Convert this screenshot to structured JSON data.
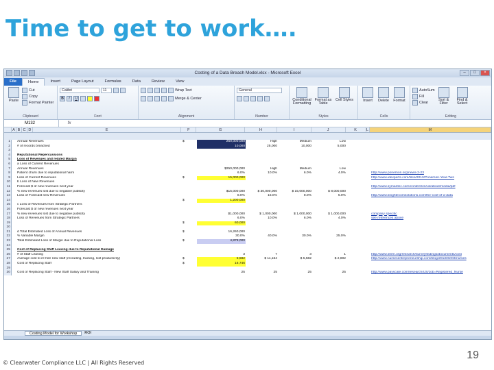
{
  "slide": {
    "title": "Time to get to work….",
    "footer": "© Clearwater Compliance LLC | All Rights Reserved",
    "page_number": "19"
  },
  "excel": {
    "window_title": "Costing of a Data Breach Model.xlsx - Microsoft Excel",
    "tabs": [
      "File",
      "Home",
      "Insert",
      "Page Layout",
      "Formulas",
      "Data",
      "Review",
      "View"
    ],
    "ribbon": {
      "clipboard": {
        "paste": "Paste",
        "cut": "Cut",
        "copy": "Copy",
        "format_painter": "Format Painter",
        "label": "Clipboard"
      },
      "font": {
        "name": "Calibri",
        "size": "11",
        "label": "Font"
      },
      "alignment": {
        "wrap": "Wrap Text",
        "merge": "Merge & Center",
        "label": "Alignment"
      },
      "number": {
        "format": "General",
        "label": "Number"
      },
      "styles": {
        "conditional": "Conditional Formatting",
        "format_table": "Format as Table",
        "cell_styles": "Cell Styles",
        "label": "Styles"
      },
      "cells": {
        "insert": "Insert",
        "delete": "Delete",
        "format": "Format",
        "label": "Cells"
      },
      "editing": {
        "autosum": "AutoSum",
        "fill": "Fill",
        "clear": "Clear",
        "sort": "Sort & Filter",
        "find": "Find & Select",
        "label": "Editing"
      }
    },
    "name_box": "M132",
    "fx": "fx",
    "columns": [
      "A",
      "B",
      "C",
      "D",
      "E",
      "F",
      "G",
      "H",
      "I",
      "J",
      "K",
      "L",
      "M"
    ],
    "rows": [
      {
        "n": "1",
        "e": "Annual Revenues",
        "f": "$",
        "g": "250,000,000",
        "h": "High",
        "i": "Medium",
        "j": "Low",
        "gcls": "hl-navy"
      },
      {
        "n": "2",
        "e": "# of records breached",
        "g": "10,000",
        "h": "25,000",
        "i": "10,000",
        "j": "5,000",
        "gcls": "hl-navy"
      },
      {
        "n": "3"
      },
      {
        "n": "4",
        "e": "Reputational Repercussions",
        "ecls": "bold"
      },
      {
        "n": "5",
        "e": "Loss of Revenues and related Margin",
        "ecls": "bold ul"
      },
      {
        "n": "6",
        "e": "a   Loss of Current Revenues"
      },
      {
        "n": "7",
        "e": "      Annual Revenues",
        "g": "$250,000,000",
        "h": "High",
        "i": "Medium",
        "j": "Low"
      },
      {
        "n": "8",
        "e": "      Patient churn due to reputational harm",
        "g": "6.0%",
        "h": "10.0%",
        "i": "6.0%",
        "j": "4.0%",
        "m": "http://www.ponemon.org/news-2-23"
      },
      {
        "n": "9",
        "e": "      Loss of Current Revenues",
        "f": "$",
        "g": "15,000,000",
        "gcls": "hl-yellow",
        "m": "http://www.idexperts.com/files/2013/Ponemon-Year-Two"
      },
      {
        "n": "10",
        "e": "b   Loss of New Revenues"
      },
      {
        "n": "11",
        "e": "      Forecast $ of new revenues next year",
        "m": "http://www.symantec.com/content/en/us/about/media/pdf"
      },
      {
        "n": "12",
        "e": "      % new revenues lost due to negative publicity",
        "g": "$15,000,000",
        "h": "$ 30,000,000",
        "i": "$ 15,000,000",
        "j": "$ 8,000,000"
      },
      {
        "n": "13",
        "e": "      Loss of Forecast new Revenues",
        "g": "8.0%",
        "h": "15.0%",
        "i": "8.0%",
        "j": "5.0%",
        "m": "http://www.knightecomsolutions.com/the-cost-of-a-data"
      },
      {
        "n": "14",
        "e": "",
        "f": "$",
        "g": "1,200,000",
        "gcls": "hl-yellow"
      },
      {
        "n": "15",
        "e": "c   Loss of Revenues from Strategic Partners"
      },
      {
        "n": "16",
        "e": "      Forecast $ of new revenues next year"
      },
      {
        "n": "17",
        "e": "      % new revenues lost due to negative publicity",
        "g": "$1,000,000",
        "h": "$ 1,000,000",
        "i": "$ 1,000,000",
        "j": "$ 1,000,000",
        "m": "company specific"
      },
      {
        "n": "18",
        "e": "      Loss of Revenues from Strategic Partners",
        "g": "6.0%",
        "h": "10.0%",
        "i": "6.0%",
        "j": "4.0%",
        "m": "see references above"
      },
      {
        "n": "19",
        "e": "",
        "f": "$",
        "g": "60,000",
        "gcls": "hl-yellow"
      },
      {
        "n": "20"
      },
      {
        "n": "21",
        "e": "d   Total Estimated Loss of Annual Revenues",
        "f": "$",
        "g": "16,260,000"
      },
      {
        "n": "22",
        "e": "      % Variable Margin",
        "g": "30.0%",
        "h": "40.0%",
        "i": "30.0%",
        "j": "25.0%"
      },
      {
        "n": "23",
        "e": "      Total Estimated Loss of Margin due to Reputational Loss",
        "f": "$",
        "g": "4,878,000",
        "gcls": "hl-lav"
      },
      {
        "n": "24"
      },
      {
        "n": "25",
        "e": "Cost of Replacing Staff Leaving due to Reputational Damage",
        "ecls": "bold ul"
      },
      {
        "n": "26",
        "e": "      # of Staff Leaving",
        "g": "3",
        "h": "7",
        "i": "3",
        "j": "1",
        "m": "http://www.shrm.org/research/surveyfindings/documents/cost"
      },
      {
        "n": "27",
        "e": "      Average cost to re-hire new staff (recruiting, training, lost productivity)",
        "f": "$",
        "g": "5,582",
        "h": "$ 11,164",
        "i": "$ 5,582",
        "j": "$ 2,802",
        "gcls": "hl-yellow",
        "m": "http://www.nursesentrepreneurship.com/blog/2013/02/03/nurses"
      },
      {
        "n": "28",
        "e": "      Cost of Replacing Staff",
        "f": "$",
        "g": "16,746",
        "gcls": "hl-yellow"
      },
      {
        "n": "29"
      },
      {
        "n": "30",
        "e": "      Cost of Replacing Staff - New Staff Salary and Training",
        "g": "25",
        "h": "25",
        "i": "25",
        "j": "25",
        "m": "http://www.payscale.com/research/US/Job=Registered_Nurse"
      }
    ],
    "sheet_tabs": [
      "Costing Model for Workshop",
      "ROI"
    ]
  }
}
